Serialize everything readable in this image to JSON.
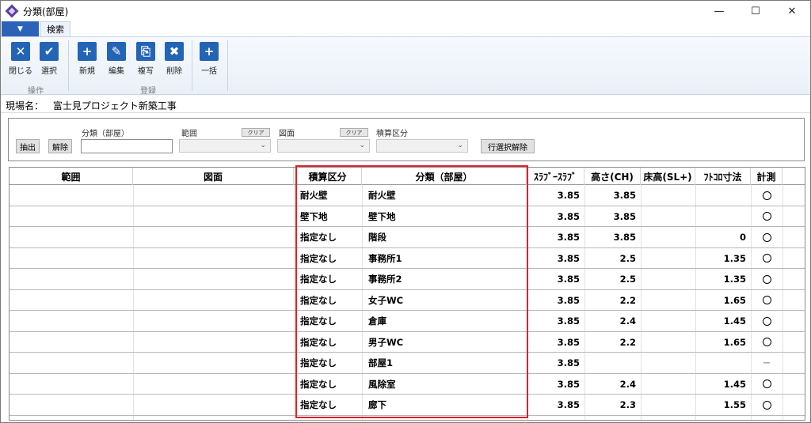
{
  "window": {
    "title": "分類(部屋)",
    "controls": [
      "minimize",
      "maximize",
      "close"
    ]
  },
  "ribbon": {
    "file_tab": "▼",
    "tabs": [
      {
        "label": "検索"
      }
    ],
    "buttons": [
      {
        "label": "閉じる",
        "icon": "close-icon"
      },
      {
        "label": "選択",
        "icon": "check-icon"
      },
      {
        "label": "新規",
        "icon": "new-document-icon"
      },
      {
        "label": "編集",
        "icon": "edit-icon"
      },
      {
        "label": "複写",
        "icon": "copy-icon"
      },
      {
        "label": "削除",
        "icon": "delete-document-icon"
      },
      {
        "label": "一括",
        "icon": "bulk-add-icon"
      }
    ],
    "groups": [
      "操作",
      "登録"
    ]
  },
  "site": {
    "label": "現場名：",
    "value": "富士見プロジェクト新築工事"
  },
  "filter": {
    "extract_label": "抽出",
    "release_label": "解除",
    "category_label": "分類（部屋）",
    "category_value": "",
    "range_label": "範囲",
    "drawing_label": "図面",
    "estimate_label": "積算区分",
    "clear_label": "クリア",
    "row_release_label": "行選択解除"
  },
  "grid": {
    "headers": [
      "範囲",
      "図面",
      "積算区分",
      "分類（部屋）",
      "ｽﾗﾌﾞｰｽﾗﾌﾞ",
      "高さ(CH)",
      "床高(SL+)",
      "ﾌﾄｺﾛ寸法",
      "計測"
    ],
    "rows": [
      {
        "range": "",
        "drawing": "",
        "estimate": "耐火壁",
        "category": "耐火壁",
        "slab": "3.85",
        "height": "3.85",
        "floor": "",
        "futokoro": "",
        "measure": "circle"
      },
      {
        "range": "",
        "drawing": "",
        "estimate": "壁下地",
        "category": "壁下地",
        "slab": "3.85",
        "height": "3.85",
        "floor": "",
        "futokoro": "",
        "measure": "circle"
      },
      {
        "range": "",
        "drawing": "",
        "estimate": "指定なし",
        "category": "階段",
        "slab": "3.85",
        "height": "3.85",
        "floor": "",
        "futokoro": "0",
        "measure": "circle"
      },
      {
        "range": "",
        "drawing": "",
        "estimate": "指定なし",
        "category": "事務所1",
        "slab": "3.85",
        "height": "2.5",
        "floor": "",
        "futokoro": "1.35",
        "measure": "circle"
      },
      {
        "range": "",
        "drawing": "",
        "estimate": "指定なし",
        "category": "事務所2",
        "slab": "3.85",
        "height": "2.5",
        "floor": "",
        "futokoro": "1.35",
        "measure": "circle"
      },
      {
        "range": "",
        "drawing": "",
        "estimate": "指定なし",
        "category": "女子WC",
        "slab": "3.85",
        "height": "2.2",
        "floor": "",
        "futokoro": "1.65",
        "measure": "circle"
      },
      {
        "range": "",
        "drawing": "",
        "estimate": "指定なし",
        "category": "倉庫",
        "slab": "3.85",
        "height": "2.4",
        "floor": "",
        "futokoro": "1.45",
        "measure": "circle"
      },
      {
        "range": "",
        "drawing": "",
        "estimate": "指定なし",
        "category": "男子WC",
        "slab": "3.85",
        "height": "2.2",
        "floor": "",
        "futokoro": "1.65",
        "measure": "circle"
      },
      {
        "range": "",
        "drawing": "",
        "estimate": "指定なし",
        "category": "部屋1",
        "slab": "3.85",
        "height": "",
        "floor": "",
        "futokoro": "",
        "measure": "－"
      },
      {
        "range": "",
        "drawing": "",
        "estimate": "指定なし",
        "category": "風除室",
        "slab": "3.85",
        "height": "2.4",
        "floor": "",
        "futokoro": "1.45",
        "measure": "circle"
      },
      {
        "range": "",
        "drawing": "",
        "estimate": "指定なし",
        "category": "廊下",
        "slab": "3.85",
        "height": "2.3",
        "floor": "",
        "futokoro": "1.55",
        "measure": "circle"
      }
    ]
  },
  "colors": {
    "accent": "#2364b5",
    "highlight": "#e0202a"
  }
}
